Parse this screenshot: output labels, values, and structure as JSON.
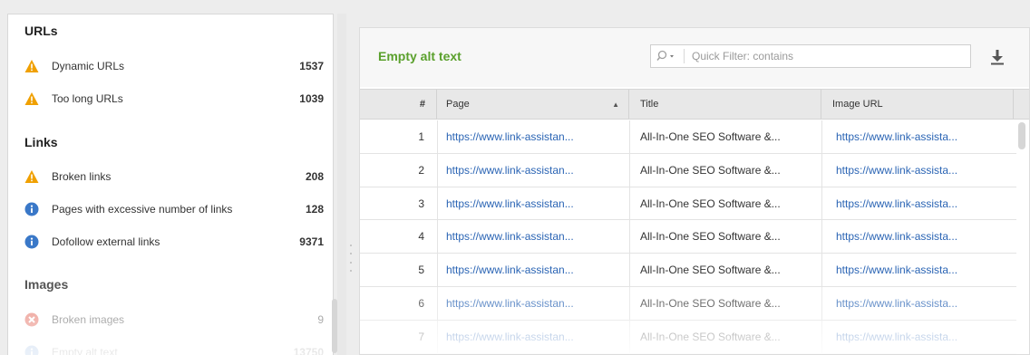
{
  "sidebar": {
    "sections": [
      {
        "title": "URLs"
      },
      {
        "title": "Links"
      },
      {
        "title": "Images"
      }
    ],
    "items": [
      {
        "label": "Dynamic URLs",
        "count": "1537",
        "icon": "warning-icon"
      },
      {
        "label": "Too long URLs",
        "count": "1039",
        "icon": "warning-icon"
      },
      {
        "label": "Broken links",
        "count": "208",
        "icon": "warning-icon"
      },
      {
        "label": "Pages with excessive number of links",
        "count": "128",
        "icon": "info-icon"
      },
      {
        "label": "Dofollow external links",
        "count": "9371",
        "icon": "info-icon"
      },
      {
        "label": "Broken images",
        "count": "9",
        "icon": "error-icon"
      },
      {
        "label": "Empty alt text",
        "count": "13750",
        "icon": "info-icon"
      }
    ]
  },
  "panel": {
    "title": "Empty alt text",
    "filter_placeholder": "Quick Filter: contains"
  },
  "table": {
    "headers": {
      "num": "#",
      "page": "Page",
      "title": "Title",
      "image": "Image URL"
    },
    "rows": [
      {
        "num": "1",
        "page": "https://www.link-assistan...",
        "title": "All-In-One SEO Software &...",
        "image": "https://www.link-assista..."
      },
      {
        "num": "2",
        "page": "https://www.link-assistan...",
        "title": "All-In-One SEO Software &...",
        "image": "https://www.link-assista..."
      },
      {
        "num": "3",
        "page": "https://www.link-assistan...",
        "title": "All-In-One SEO Software &...",
        "image": "https://www.link-assista..."
      },
      {
        "num": "4",
        "page": "https://www.link-assistan...",
        "title": "All-In-One SEO Software &...",
        "image": "https://www.link-assista..."
      },
      {
        "num": "5",
        "page": "https://www.link-assistan...",
        "title": "All-In-One SEO Software &...",
        "image": "https://www.link-assista..."
      },
      {
        "num": "6",
        "page": "https://www.link-assistan...",
        "title": "All-In-One SEO Software &...",
        "image": "https://www.link-assista..."
      },
      {
        "num": "7",
        "page": "https://www.link-assistan...",
        "title": "All-In-One SEO Software &...",
        "image": "https://www.link-assista..."
      }
    ]
  },
  "colors": {
    "warning": "#f0a000",
    "info": "#3a78c8",
    "error": "#e05040",
    "title_green": "#5aa02c",
    "link_blue": "#2a64b4"
  }
}
